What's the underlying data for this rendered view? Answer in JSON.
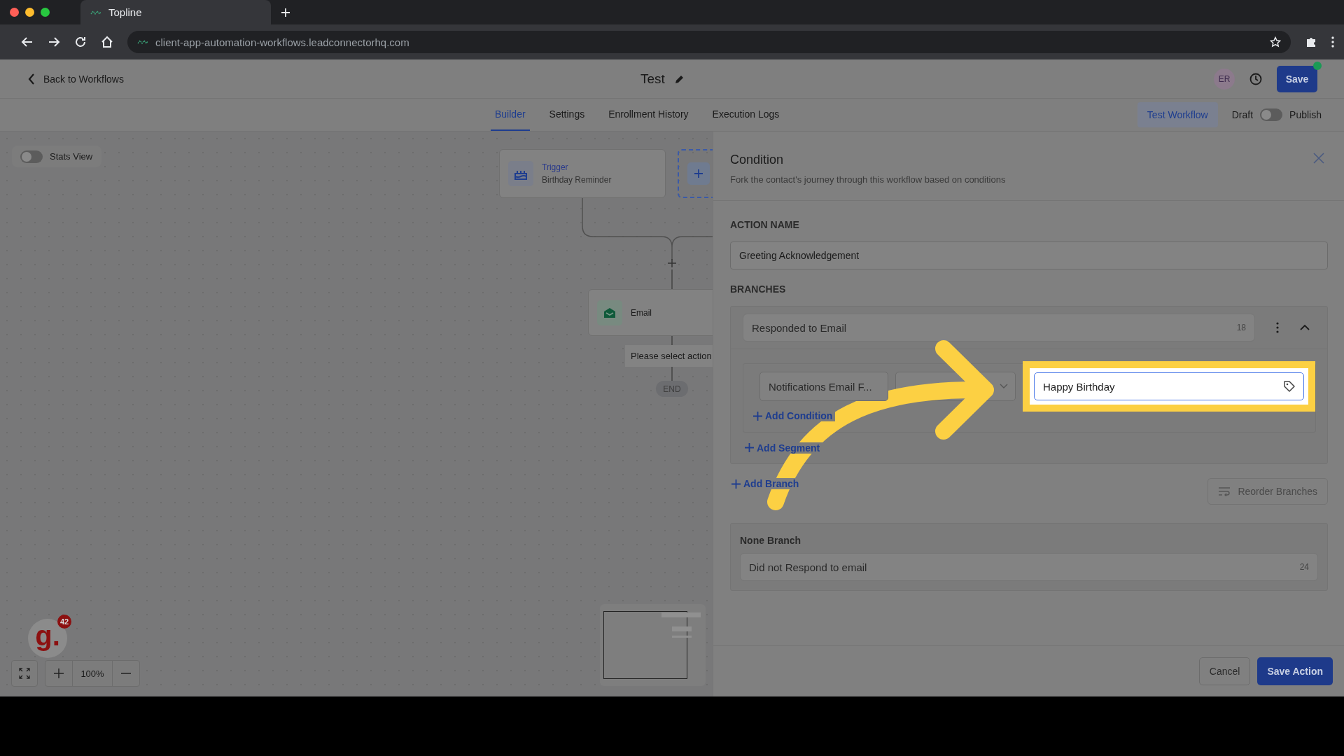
{
  "browser": {
    "tab_title": "Topline",
    "url": "client-app-automation-workflows.leadconnectorhq.com"
  },
  "header": {
    "back_link": "Back to Workflows",
    "title": "Test",
    "avatar": "ER",
    "save_button": "Save"
  },
  "tabs": [
    {
      "label": "Builder",
      "selected": true
    },
    {
      "label": "Settings",
      "selected": false
    },
    {
      "label": "Enrollment History",
      "selected": false
    },
    {
      "label": "Execution Logs",
      "selected": false
    }
  ],
  "toolbar": {
    "test_button": "Test Workflow",
    "draft_label": "Draft",
    "publish_on": false,
    "publish_label": "Publish"
  },
  "canvas": {
    "stats_view": {
      "label": "Stats View",
      "on": false
    },
    "nodes": [
      {
        "kind": "trigger",
        "title": "Trigger",
        "subtitle": "Birthday Reminder"
      },
      {
        "kind": "email",
        "title": "Email"
      }
    ],
    "tooltip": "Please select action",
    "end_label": "END",
    "zoom": "100%"
  },
  "widget": {
    "logo": "g.",
    "count": "42"
  },
  "panel": {
    "title": "Condition",
    "subtitle": "Fork the contact's journey through this workflow based on conditions",
    "action_name_label": "ACTION NAME",
    "action_name": "Greeting Acknowledgement",
    "branches_label": "BRANCHES",
    "branches": [
      {
        "name": "Responded to Email",
        "count": "18",
        "expanded": true,
        "conditions": [
          {
            "field": "Notifications Email F...",
            "value": "Happy Birthday",
            "highlighted": true
          }
        ],
        "add_condition": "Add Condition",
        "add_segment": "Add Segment"
      }
    ],
    "add_branch": "Add Branch",
    "reorder_button": "Reorder Branches",
    "none_branch": {
      "label": "None Branch",
      "name": "Did not Respond to email",
      "count": "24"
    },
    "cancel_button": "Cancel",
    "save_button": "Save Action"
  }
}
